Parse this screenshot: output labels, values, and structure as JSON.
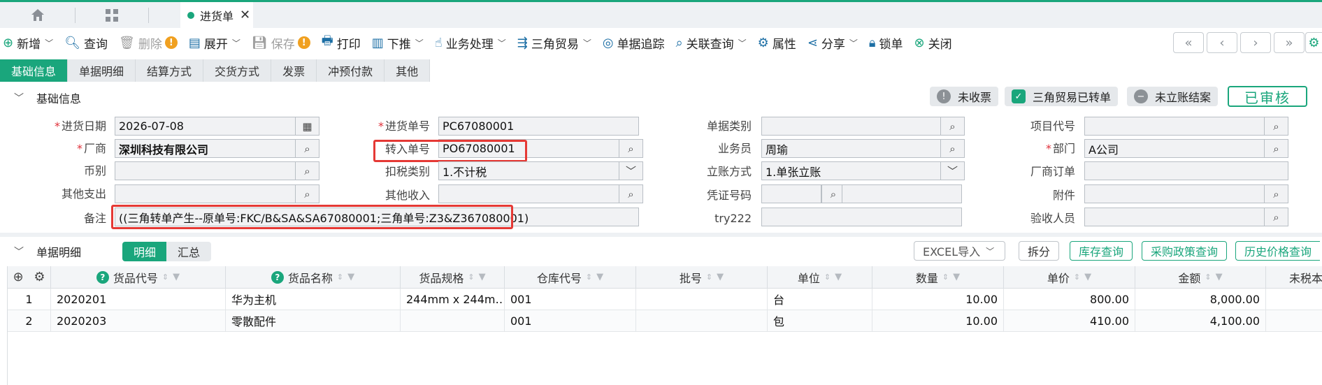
{
  "tabs": {
    "doc_tab_label": "进货单",
    "close_glyph": "✕"
  },
  "toolbar": {
    "new": "新增",
    "query": "查询",
    "delete": "删除",
    "expand": "展开",
    "save": "保存",
    "print": "打印",
    "push_down": "下推",
    "business": "业务处理",
    "triangle_trade": "三角贸易",
    "doc_trace": "单据追踪",
    "related_query": "关联查询",
    "properties": "属性",
    "share": "分享",
    "lock": "锁单",
    "close": "关闭"
  },
  "subtabs": [
    "基础信息",
    "单据明细",
    "结算方式",
    "交货方式",
    "发票",
    "冲预付款",
    "其他"
  ],
  "section_basic": {
    "title": "基础信息",
    "badge_uninvoiced": "未收票",
    "badge_triangle": "三角贸易已转单",
    "badge_unsettled": "未立账结案",
    "status": "已审核"
  },
  "form": {
    "purchase_date_label": "进货日期",
    "purchase_date": "2026-07-08",
    "vendor_label": "厂商",
    "vendor": "深圳科技有限公司",
    "currency_label": "币别",
    "currency": "",
    "other_expense_label": "其他支出",
    "other_expense": "",
    "remark_label": "备注",
    "remark": "((三角转单产生--原单号:FKC/B&SA&SA67080001;三角单号:Z3&Z367080001)",
    "purchase_no_label": "进货单号",
    "purchase_no": "PC67080001",
    "transfer_no_label": "转入单号",
    "transfer_no": "PO67080001",
    "tax_type_label": "扣税类别",
    "tax_type": "1.不计税",
    "other_income_label": "其他收入",
    "other_income": "",
    "doc_category_label": "单据类别",
    "doc_category": "",
    "salesman_label": "业务员",
    "salesman": "周瑜",
    "account_method_label": "立账方式",
    "account_method": "1.单张立账",
    "voucher_no_label": "凭证号码",
    "voucher_no": "",
    "try_label": "try222",
    "try_value": "",
    "project_code_label": "项目代号",
    "project_code": "",
    "department_label": "部门",
    "department": "A公司",
    "vendor_order_label": "厂商订单",
    "vendor_order": "",
    "attachment_label": "附件",
    "attachment": "",
    "inspector_label": "验收人员",
    "inspector": ""
  },
  "detail": {
    "title": "单据明细",
    "seg_detail": "明细",
    "seg_summary": "汇总",
    "excel_import": "EXCEL导入",
    "split": "拆分",
    "stock_query": "库存查询",
    "policy_query": "采购政策查询",
    "history_price": "历史价格查询"
  },
  "table": {
    "headers": [
      "货品代号",
      "货品名称",
      "货品规格",
      "仓库代号",
      "批号",
      "单位",
      "数量",
      "单价",
      "金额",
      "未税本"
    ],
    "rows": [
      {
        "no": "1",
        "code": "2020201",
        "name": "华为主机",
        "spec": "244mm x 244m…",
        "warehouse": "001",
        "batch": "",
        "unit": "台",
        "qty": "10.00",
        "price": "800.00",
        "amount": "8,000.00"
      },
      {
        "no": "2",
        "code": "2020203",
        "name": "零散配件",
        "spec": "",
        "warehouse": "001",
        "batch": "",
        "unit": "包",
        "qty": "10.00",
        "price": "410.00",
        "amount": "4,100.00"
      }
    ]
  },
  "colors": {
    "accent": "#1aa67c",
    "highlight_box": "#e53935",
    "warning": "#f0a020"
  }
}
